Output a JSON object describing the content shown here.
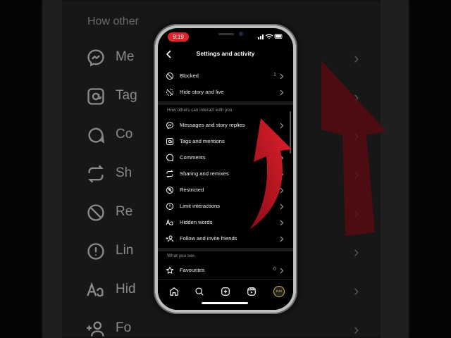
{
  "background": {
    "section_label": "How other",
    "rows": [
      "Me",
      "Tag",
      "Co",
      "Sh",
      "Re",
      "Lin",
      "Hid",
      "Fo"
    ]
  },
  "status": {
    "time": "9:19"
  },
  "header": {
    "title": "Settings and activity"
  },
  "rows_top": [
    {
      "label": "Blocked",
      "count": "1",
      "icon": "blocked-icon"
    },
    {
      "label": "Hide story and live",
      "count": "",
      "icon": "hide-story-icon"
    }
  ],
  "section_interact": {
    "label": "How others can interact with you",
    "items": [
      {
        "label": "Messages and story replies",
        "icon": "messenger-icon"
      },
      {
        "label": "Tags and mentions",
        "icon": "at-sign-icon"
      },
      {
        "label": "Comments",
        "icon": "comment-icon"
      },
      {
        "label": "Sharing and remixes",
        "icon": "share-remix-icon"
      },
      {
        "label": "Restricted",
        "icon": "restricted-icon"
      },
      {
        "label": "Limit interactions",
        "icon": "limit-icon"
      },
      {
        "label": "Hidden words",
        "icon": "text-aa-icon"
      },
      {
        "label": "Follow and invite friends",
        "icon": "add-person-icon"
      }
    ]
  },
  "section_see": {
    "label": "What you see",
    "items": [
      {
        "label": "Favourites",
        "count": "0",
        "icon": "star-icon"
      }
    ]
  },
  "tabbar": {
    "avatar_initials": "RJH",
    "tabs": [
      "home-icon",
      "search-icon",
      "create-icon",
      "reels-icon",
      "profile-avatar"
    ]
  },
  "colors": {
    "accent_red": "#c4111f",
    "background": "#000000",
    "text": "#f2f2f2"
  }
}
